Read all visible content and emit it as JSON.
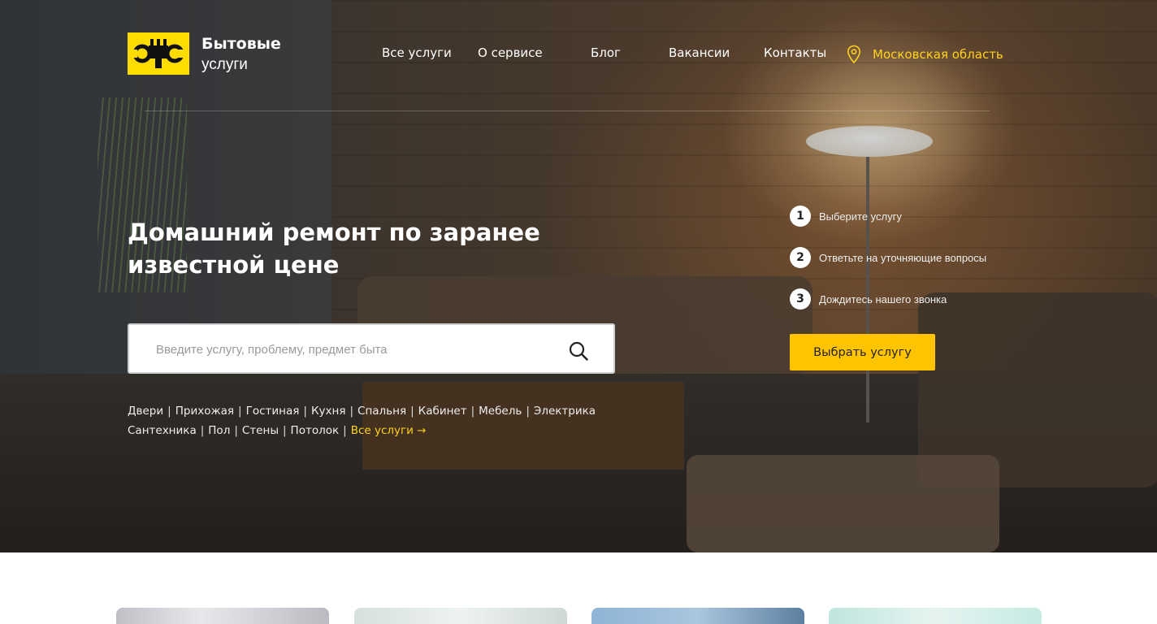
{
  "brand": {
    "line1": "Бытовые",
    "line2": "услуги",
    "logo_color": "#ffdc00"
  },
  "nav": {
    "items": [
      "Все услуги",
      "О сервисе",
      "Блог",
      "Вакансии",
      "Контакты"
    ],
    "location": "Московская область"
  },
  "hero": {
    "headline": "Домашний ремонт по заранее известной цене",
    "search_placeholder": "Введите услугу, проблему, предмет быта",
    "tags": [
      "Двери",
      "Прихожая",
      "Гостиная",
      "Кухня",
      "Спальня",
      "Кабинет",
      "Мебель",
      "Электрика",
      "Сантехника",
      "Пол",
      "Стены",
      "Потолок"
    ],
    "all_services": "Все услуги →"
  },
  "steps": [
    {
      "n": "1",
      "text": "Выберите услугу"
    },
    {
      "n": "2",
      "text": "Ответьте на уточняющие вопросы"
    },
    {
      "n": "3",
      "text": "Дождитесь нашего звонка"
    }
  ],
  "cta": {
    "label": "Выбрать услугу",
    "color": "#ffc400"
  },
  "colors": {
    "accent": "#ffd21f"
  }
}
